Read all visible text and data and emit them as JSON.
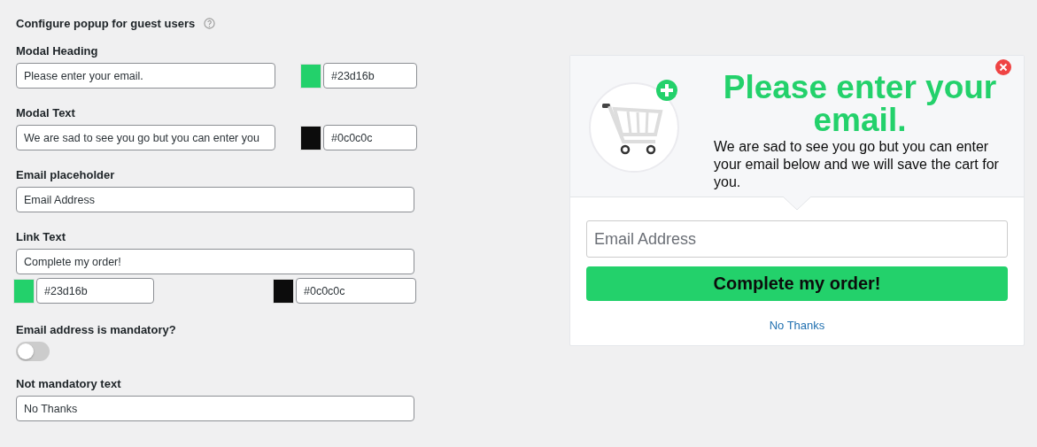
{
  "settings": {
    "title": "Configure popup for guest users",
    "modal_heading": {
      "label": "Modal Heading",
      "value": "Please enter your email.",
      "color_value": "#23d16b"
    },
    "modal_text": {
      "label": "Modal Text",
      "value": "We are sad to see you go but you can enter you",
      "color_value": "#0c0c0c"
    },
    "email_placeholder": {
      "label": "Email placeholder",
      "value": "Email Address"
    },
    "link_text": {
      "label": "Link Text",
      "value": "Complete my order!",
      "background_color_value": "#23d16b",
      "text_color_value": "#0c0c0c"
    },
    "mandatory": {
      "label": "Email address is mandatory?",
      "on": false
    },
    "not_mandatory_text": {
      "label": "Not mandatory text",
      "value": "No Thanks"
    }
  },
  "preview": {
    "heading": "Please enter your email.",
    "text": "We are sad to see you go but you can enter your email below and we will save the cart for you.",
    "email_placeholder": "Email Address",
    "button": "Complete my order!",
    "link": "No Thanks"
  }
}
